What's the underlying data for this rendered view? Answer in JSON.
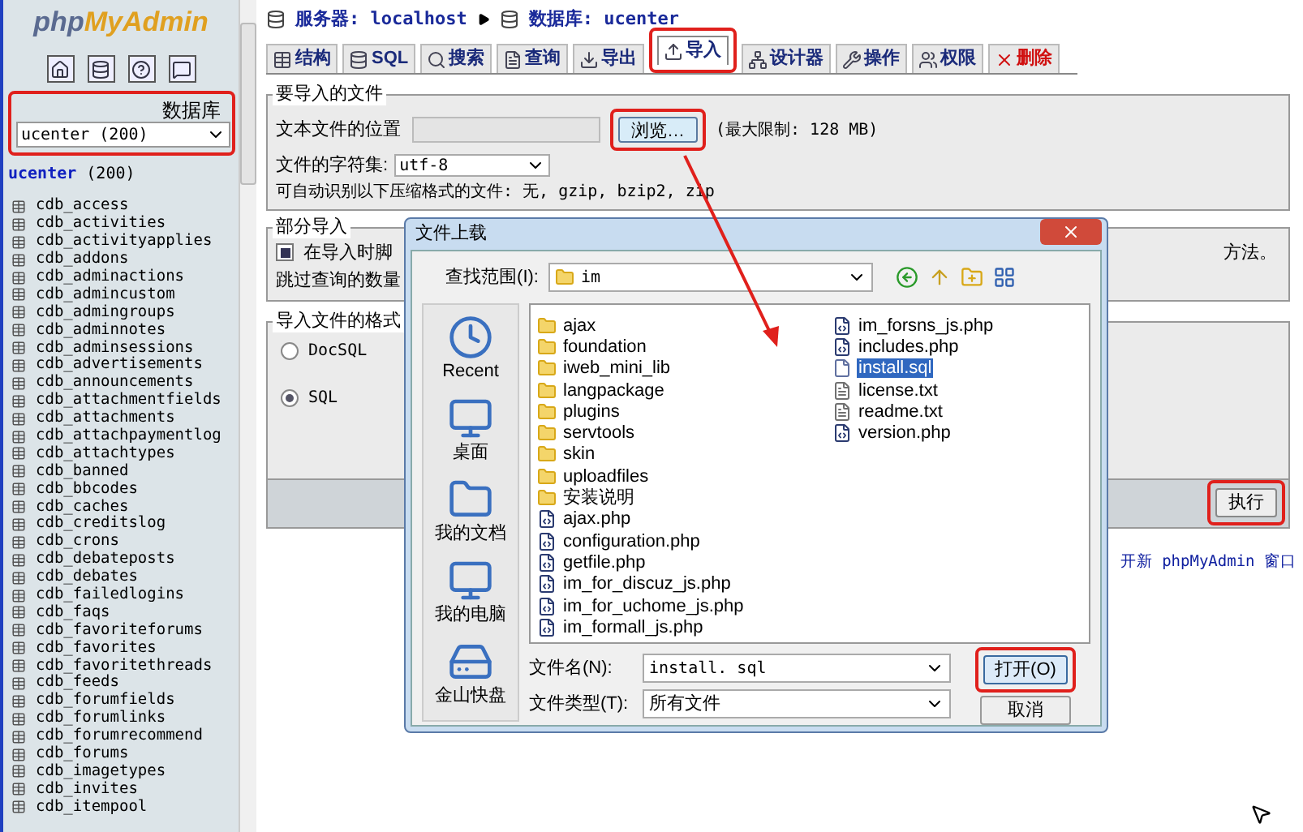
{
  "sidebar": {
    "logo": {
      "part1": "php",
      "part2": "MyAdmin"
    },
    "database_label": "数据库",
    "database_select": {
      "value": "ucenter (200)",
      "highlighted": true
    },
    "current_db": {
      "name": "ucenter",
      "count": "(200)"
    },
    "tables": [
      "cdb_access",
      "cdb_activities",
      "cdb_activityapplies",
      "cdb_addons",
      "cdb_adminactions",
      "cdb_admincustom",
      "cdb_admingroups",
      "cdb_adminnotes",
      "cdb_adminsessions",
      "cdb_advertisements",
      "cdb_announcements",
      "cdb_attachmentfields",
      "cdb_attachments",
      "cdb_attachpaymentlog",
      "cdb_attachtypes",
      "cdb_banned",
      "cdb_bbcodes",
      "cdb_caches",
      "cdb_creditslog",
      "cdb_crons",
      "cdb_debateposts",
      "cdb_debates",
      "cdb_failedlogins",
      "cdb_faqs",
      "cdb_favoriteforums",
      "cdb_favorites",
      "cdb_favoritethreads",
      "cdb_feeds",
      "cdb_forumfields",
      "cdb_forumlinks",
      "cdb_forumrecommend",
      "cdb_forums",
      "cdb_imagetypes",
      "cdb_invites",
      "cdb_itempool"
    ]
  },
  "breadcrumb": {
    "server": "服务器: localhost",
    "database": "数据库: ucenter"
  },
  "tabs": [
    {
      "label": "结构",
      "selected": false,
      "highlighted": false,
      "danger": false
    },
    {
      "label": "SQL",
      "selected": false,
      "highlighted": false,
      "danger": false
    },
    {
      "label": "搜索",
      "selected": false,
      "highlighted": false,
      "danger": false
    },
    {
      "label": "查询",
      "selected": false,
      "highlighted": false,
      "danger": false
    },
    {
      "label": "导出",
      "selected": false,
      "highlighted": false,
      "danger": false
    },
    {
      "label": "导入",
      "selected": true,
      "highlighted": true,
      "danger": false
    },
    {
      "label": "设计器",
      "selected": false,
      "highlighted": false,
      "danger": false
    },
    {
      "label": "操作",
      "selected": false,
      "highlighted": false,
      "danger": false
    },
    {
      "label": "权限",
      "selected": false,
      "highlighted": false,
      "danger": false
    },
    {
      "label": "删除",
      "selected": false,
      "highlighted": false,
      "danger": true
    }
  ],
  "import_file": {
    "legend": "要导入的文件",
    "location_label": "文本文件的位置",
    "browse_button": "浏览…",
    "browse_highlighted": true,
    "max_size": "(最大限制: 128 MB)",
    "charset_label": "文件的字符集:",
    "charset_value": "utf-8",
    "compression_note": "可自动识别以下压缩格式的文件: 无, gzip, bzip2, zip"
  },
  "partial_import": {
    "legend": "部分导入",
    "checkbox_label": "在导入时脚",
    "checked": true,
    "tail": "方法。",
    "skip_label": "跳过查询的数量"
  },
  "format": {
    "legend": "导入文件的格式",
    "options": [
      {
        "label": "DocSQL",
        "selected": false
      },
      {
        "label": "SQL",
        "selected": true
      }
    ]
  },
  "execute_button": {
    "label": "执行",
    "highlighted": true
  },
  "link_text": "开新 phpMyAdmin 窗口",
  "dialog": {
    "title": "文件上载",
    "look_in_label": "查找范围(I):",
    "look_in_value": "im",
    "places": [
      "Recent",
      "桌面",
      "我的文档",
      "我的电脑",
      "金山快盘"
    ],
    "files": [
      {
        "name": "ajax",
        "kind": "folder",
        "selected": false
      },
      {
        "name": "foundation",
        "kind": "folder",
        "selected": false
      },
      {
        "name": "iweb_mini_lib",
        "kind": "folder",
        "selected": false
      },
      {
        "name": "langpackage",
        "kind": "folder",
        "selected": false
      },
      {
        "name": "plugins",
        "kind": "folder",
        "selected": false
      },
      {
        "name": "servtools",
        "kind": "folder",
        "selected": false
      },
      {
        "name": "skin",
        "kind": "folder",
        "selected": false
      },
      {
        "name": "uploadfiles",
        "kind": "folder",
        "selected": false
      },
      {
        "name": "安装说明",
        "kind": "folder",
        "selected": false
      },
      {
        "name": "ajax.php",
        "kind": "php",
        "selected": false
      },
      {
        "name": "configuration.php",
        "kind": "php",
        "selected": false
      },
      {
        "name": "getfile.php",
        "kind": "php",
        "selected": false
      },
      {
        "name": "im_for_discuz_js.php",
        "kind": "php",
        "selected": false
      },
      {
        "name": "im_for_uchome_js.php",
        "kind": "php",
        "selected": false
      },
      {
        "name": "im_formall_js.php",
        "kind": "php",
        "selected": false
      },
      {
        "name": "im_forsns_js.php",
        "kind": "php",
        "selected": false
      },
      {
        "name": "includes.php",
        "kind": "php",
        "selected": false
      },
      {
        "name": "install.sql",
        "kind": "sql",
        "selected": true
      },
      {
        "name": "license.txt",
        "kind": "txt",
        "selected": false
      },
      {
        "name": "readme.txt",
        "kind": "txt",
        "selected": false
      },
      {
        "name": "version.php",
        "kind": "php",
        "selected": false
      }
    ],
    "filename_label": "文件名(N):",
    "filename_value": "install. sql",
    "filetype_label": "文件类型(T):",
    "filetype_value": "所有文件",
    "open_button": {
      "label": "打开(O)",
      "highlighted": true
    },
    "cancel_button": "取消"
  }
}
